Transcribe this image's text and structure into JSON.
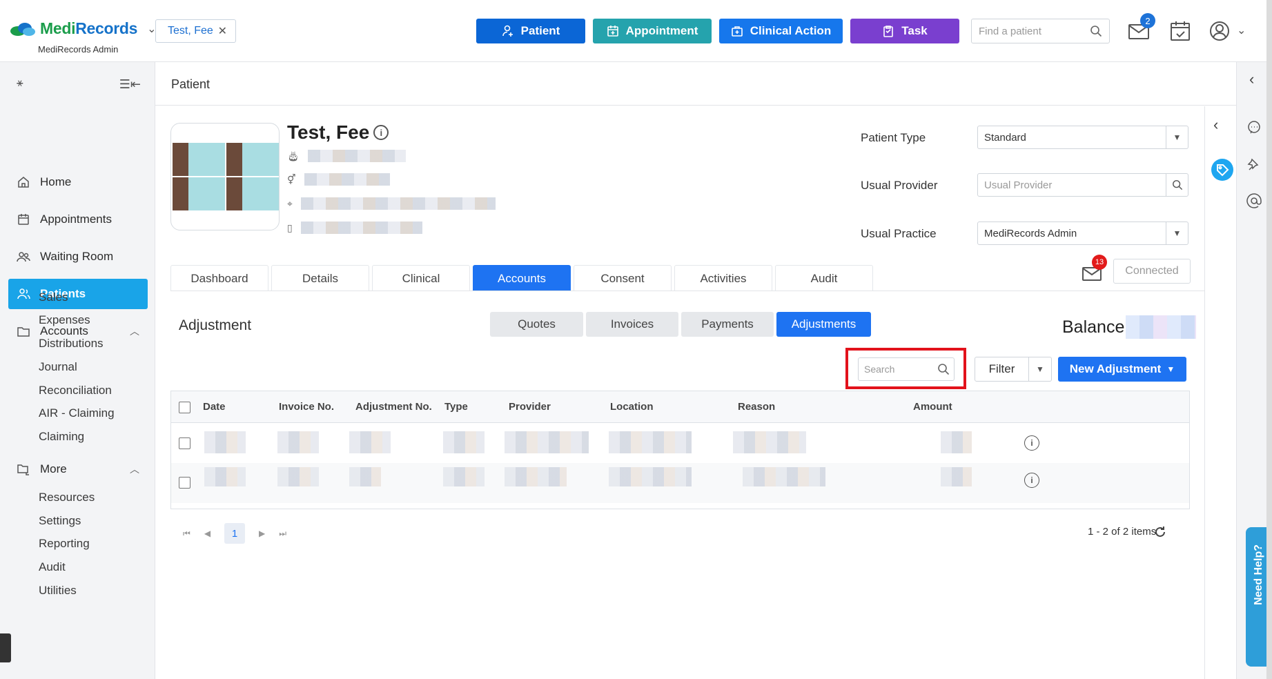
{
  "app": {
    "brand_medi": "Medi",
    "brand_records": "Records",
    "subtitle": "MediRecords Admin"
  },
  "open_patient_tab": "Test, Fee",
  "toolbar": {
    "patient": "Patient",
    "appointment": "Appointment",
    "clinical_action": "Clinical Action",
    "task": "Task",
    "find_placeholder": "Find a patient",
    "mail_badge": "2"
  },
  "colors": {
    "patient_btn": "#0b66d6",
    "appointment_btn": "#25a3ad",
    "clinical_btn": "#1677ec",
    "task_btn": "#7a3fcf",
    "accent": "#1e73f2",
    "active_nav": "#19a4e8",
    "highlight": "#e2121b"
  },
  "sidebar": {
    "items": [
      {
        "label": "Home",
        "icon": "home-icon"
      },
      {
        "label": "Appointments",
        "icon": "calendar-icon"
      },
      {
        "label": "Waiting Room",
        "icon": "users-icon"
      },
      {
        "label": "Patients",
        "icon": "patients-icon",
        "active": true
      },
      {
        "label": "Accounts",
        "icon": "folder-icon"
      },
      {
        "label": "More",
        "icon": "folder-tree-icon"
      }
    ],
    "accounts_sub": [
      "Sales",
      "Expenses",
      "Distributions",
      "Journal",
      "Reconciliation",
      "AIR - Claiming",
      "Claiming"
    ],
    "more_sub": [
      "Resources",
      "Settings",
      "Reporting",
      "Audit",
      "Utilities"
    ]
  },
  "page": {
    "title": "Patient",
    "patient_name": "Test, Fee",
    "fields": {
      "patient_type_label": "Patient Type",
      "patient_type_value": "Standard",
      "usual_provider_label": "Usual Provider",
      "usual_provider_placeholder": "Usual Provider",
      "usual_practice_label": "Usual Practice",
      "usual_practice_value": "MediRecords Admin"
    },
    "tabs": [
      "Dashboard",
      "Details",
      "Clinical",
      "Accounts",
      "Consent",
      "Activities",
      "Audit"
    ],
    "active_tab": "Accounts",
    "message_badge": "13",
    "connected_label": "Connected"
  },
  "adjustment": {
    "section_title": "Adjustment",
    "subtabs": [
      "Quotes",
      "Invoices",
      "Payments",
      "Adjustments"
    ],
    "active_subtab": "Adjustments",
    "balance_label": "Balance",
    "search_placeholder": "Search",
    "filter_label": "Filter",
    "new_button": "New Adjustment",
    "columns": [
      "Date",
      "Invoice No.",
      "Adjustment No.",
      "Type",
      "Provider",
      "Location",
      "Reason",
      "Amount"
    ],
    "page_number": "1",
    "items_count": "1 - 2 of 2 items"
  },
  "help_label": "Need Help?"
}
